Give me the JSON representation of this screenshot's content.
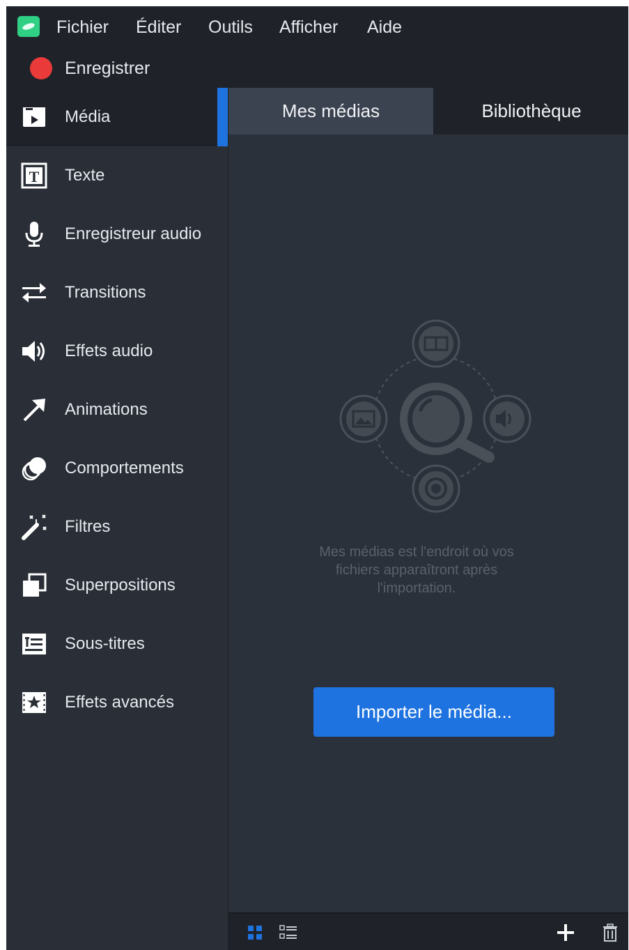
{
  "menubar": {
    "items": [
      "Fichier",
      "Éditer",
      "Outils",
      "Afficher",
      "Aide"
    ],
    "record_label": "Enregistrer"
  },
  "sidebar": {
    "items": [
      {
        "label": "Média",
        "icon": "media-icon",
        "active": true
      },
      {
        "label": "Texte",
        "icon": "text-icon"
      },
      {
        "label": "Enregistreur audio",
        "icon": "microphone-icon"
      },
      {
        "label": "Transitions",
        "icon": "transitions-icon"
      },
      {
        "label": "Effets audio",
        "icon": "speaker-icon"
      },
      {
        "label": "Animations",
        "icon": "arrow-icon"
      },
      {
        "label": "Comportements",
        "icon": "behaviors-icon"
      },
      {
        "label": "Filtres",
        "icon": "magic-wand-icon"
      },
      {
        "label": "Superpositions",
        "icon": "overlay-icon"
      },
      {
        "label": "Sous-titres",
        "icon": "subtitles-icon"
      },
      {
        "label": "Effets avancés",
        "icon": "advanced-effects-icon"
      }
    ]
  },
  "tabs": {
    "mes_medias": "Mes médias",
    "bibliotheque": "Bibliothèque"
  },
  "empty_state": {
    "line1": "Mes médias est l'endroit où vos",
    "line2": "fichiers apparaîtront après",
    "line3": "l'importation."
  },
  "import_button": "Importer le média...",
  "colors": {
    "accent": "#1e73e0",
    "record": "#ea3a3a",
    "logo": "#2fcf84"
  }
}
